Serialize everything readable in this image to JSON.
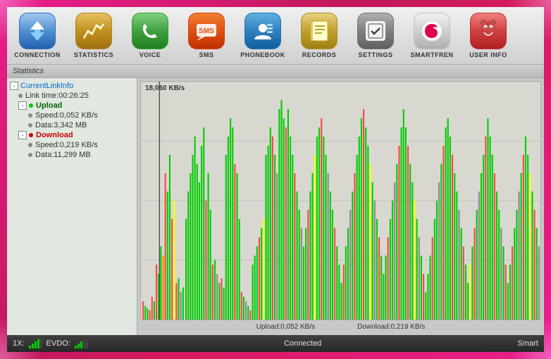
{
  "toolbar": {
    "items": [
      {
        "id": "connection",
        "label": "CONNECTION",
        "icon_class": "icon-connection",
        "icon_char": "⬇⬆"
      },
      {
        "id": "statistics",
        "label": "STATISTICS",
        "icon_class": "icon-statistics",
        "icon_char": "📈"
      },
      {
        "id": "voice",
        "label": "VOICE",
        "icon_class": "icon-voice",
        "icon_char": "📞"
      },
      {
        "id": "sms",
        "label": "SMS",
        "icon_class": "icon-sms",
        "icon_char": "SMS"
      },
      {
        "id": "phonebook",
        "label": "PHONEBOOK",
        "icon_class": "icon-phonebook",
        "icon_char": "👤"
      },
      {
        "id": "records",
        "label": "RECORDS",
        "icon_class": "icon-records",
        "icon_char": "📋"
      },
      {
        "id": "settings",
        "label": "SETTINGS",
        "icon_class": "icon-settings",
        "icon_char": "☑"
      },
      {
        "id": "smartfren",
        "label": "SMARTFREN",
        "icon_class": "icon-smartfren",
        "icon_char": "S"
      },
      {
        "id": "userinfo",
        "label": "USER INFO",
        "icon_class": "icon-userinfo",
        "icon_char": "🐵"
      }
    ]
  },
  "stats_header": "Statistics",
  "tree": {
    "root": "CurrentLinkInfo",
    "link_time_label": "Link time:",
    "link_time_value": "00:26:25",
    "upload_label": "Upload",
    "upload_speed_label": "Speed:",
    "upload_speed_value": "0,052 KB/s",
    "upload_data_label": "Data:",
    "upload_data_value": "3,342 MB",
    "download_label": "Download",
    "download_speed_label": "Speed:",
    "download_speed_value": "0,219 KB/s",
    "download_data_label": "Data:",
    "download_data_value": "11,299 MB"
  },
  "chart": {
    "max_label": "18,060 KB/s",
    "upload_label": "Upload:",
    "upload_value": "0,052 KB/s",
    "download_label": "Download:",
    "download_value": "0,219 KB/s"
  },
  "status_bar": {
    "signal_prefix": "1X:",
    "evdo_label": "EVDO:",
    "connected_label": "Connected",
    "network_label": "Smart"
  }
}
